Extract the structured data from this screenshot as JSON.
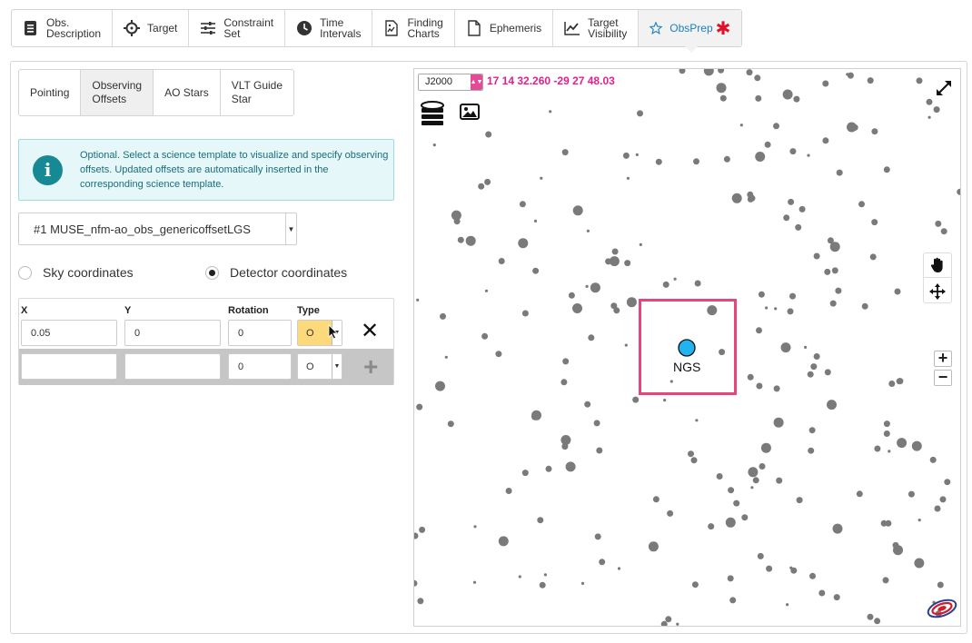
{
  "toolbar": {
    "items": [
      {
        "label": "Obs.\nDescription",
        "icon": "document-icon"
      },
      {
        "label": "Target",
        "icon": "crosshair-icon"
      },
      {
        "label": "Constraint\nSet",
        "icon": "sliders-icon"
      },
      {
        "label": "Time\nIntervals",
        "icon": "clock-icon"
      },
      {
        "label": "Finding\nCharts",
        "icon": "chart-file-icon"
      },
      {
        "label": "Ephemeris",
        "icon": "file-icon"
      },
      {
        "label": "Target\nVisibility",
        "icon": "line-chart-icon"
      },
      {
        "label": "ObsPrep",
        "icon": "star-icon",
        "active": true
      }
    ],
    "required_mark": "✱",
    "accent_color": "#1a7fc1",
    "required_color": "#e0102a"
  },
  "subtabs": [
    {
      "label": "Pointing"
    },
    {
      "label": "Observing\nOffsets",
      "active": true
    },
    {
      "label": "AO Stars"
    },
    {
      "label": "VLT Guide\nStar"
    }
  ],
  "info": {
    "text": "Optional. Select a science template to visualize and specify observing offsets. Updated offsets are automatically inserted in the corresponding science template.",
    "icon": "info-icon"
  },
  "template_select": {
    "value": "#1 MUSE_nfm-ao_obs_genericoffsetLGS"
  },
  "coords": {
    "sky_label": "Sky coordinates",
    "detector_label": "Detector coordinates",
    "selected": "detector"
  },
  "offsets": {
    "headers": {
      "x": "X",
      "y": "Y",
      "rotation": "Rotation",
      "type": "Type"
    },
    "rows": [
      {
        "x": "0.05",
        "y": "0",
        "rotation": "0",
        "type": "O"
      },
      {
        "x": "",
        "y": "",
        "rotation": "0",
        "type": "O"
      }
    ],
    "delete_glyph": "✕",
    "add_glyph": "+"
  },
  "map": {
    "frame": "J2000",
    "coordinates": "17 14 32.260 -29 27 48.03",
    "ngs_label": "NGS",
    "zoom_in": "+",
    "zoom_out": "−",
    "fov_color": "#e8457f",
    "ngs_color": "#1fb3ef",
    "coord_color": "#e21f8f"
  }
}
